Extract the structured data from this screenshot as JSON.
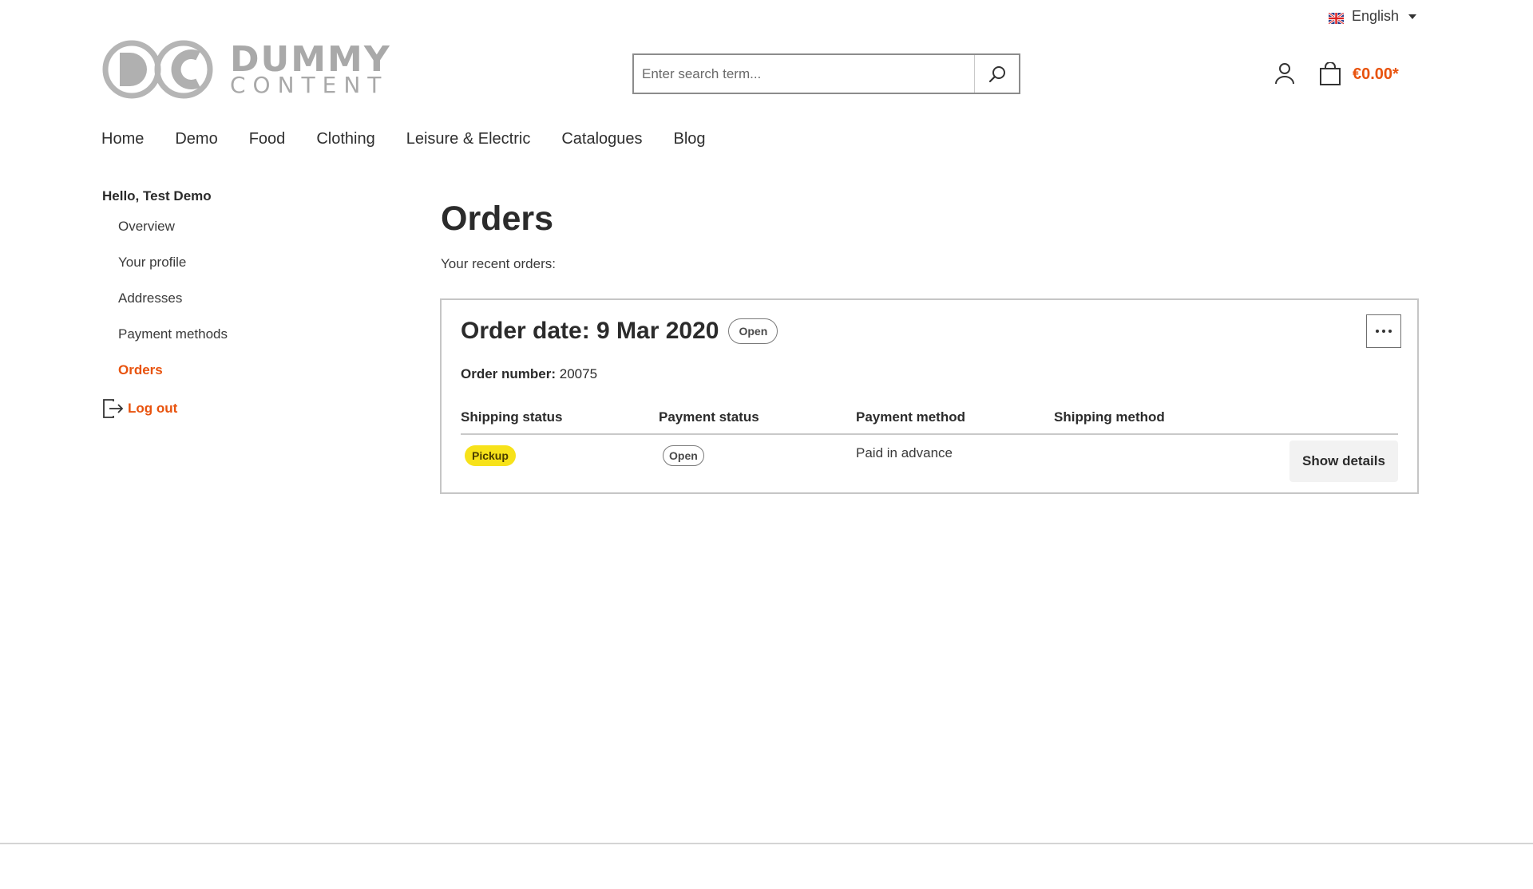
{
  "language": {
    "label": "English"
  },
  "logo": {
    "line1": "DUMMY",
    "line2": "CONTENT",
    "brand_color": "#a9a9a9"
  },
  "search": {
    "placeholder": "Enter search term..."
  },
  "cart": {
    "total": "€0.00*"
  },
  "nav": [
    {
      "label": "Home"
    },
    {
      "label": "Demo"
    },
    {
      "label": "Food"
    },
    {
      "label": "Clothing"
    },
    {
      "label": "Leisure & Electric"
    },
    {
      "label": "Catalogues"
    },
    {
      "label": "Blog"
    }
  ],
  "sidebar": {
    "greeting": "Hello, Test Demo",
    "items": [
      {
        "label": "Overview"
      },
      {
        "label": "Your profile"
      },
      {
        "label": "Addresses"
      },
      {
        "label": "Payment methods"
      },
      {
        "label": "Orders"
      }
    ],
    "logout": "Log out"
  },
  "page": {
    "title": "Orders",
    "subtitle": "Your recent orders:"
  },
  "order": {
    "date_label": "Order date: 9 Mar 2020",
    "status": "Open",
    "number_label": "Order number:",
    "number": "20075",
    "columns": [
      "Shipping status",
      "Payment status",
      "Payment method",
      "Shipping method"
    ],
    "shipping_status": "Pickup",
    "payment_status": "Open",
    "payment_method": "Paid in advance",
    "shipping_method": "",
    "details_button": "Show details"
  },
  "colors": {
    "accent": "#e8530e",
    "pickup_badge": "#f7e21a"
  }
}
